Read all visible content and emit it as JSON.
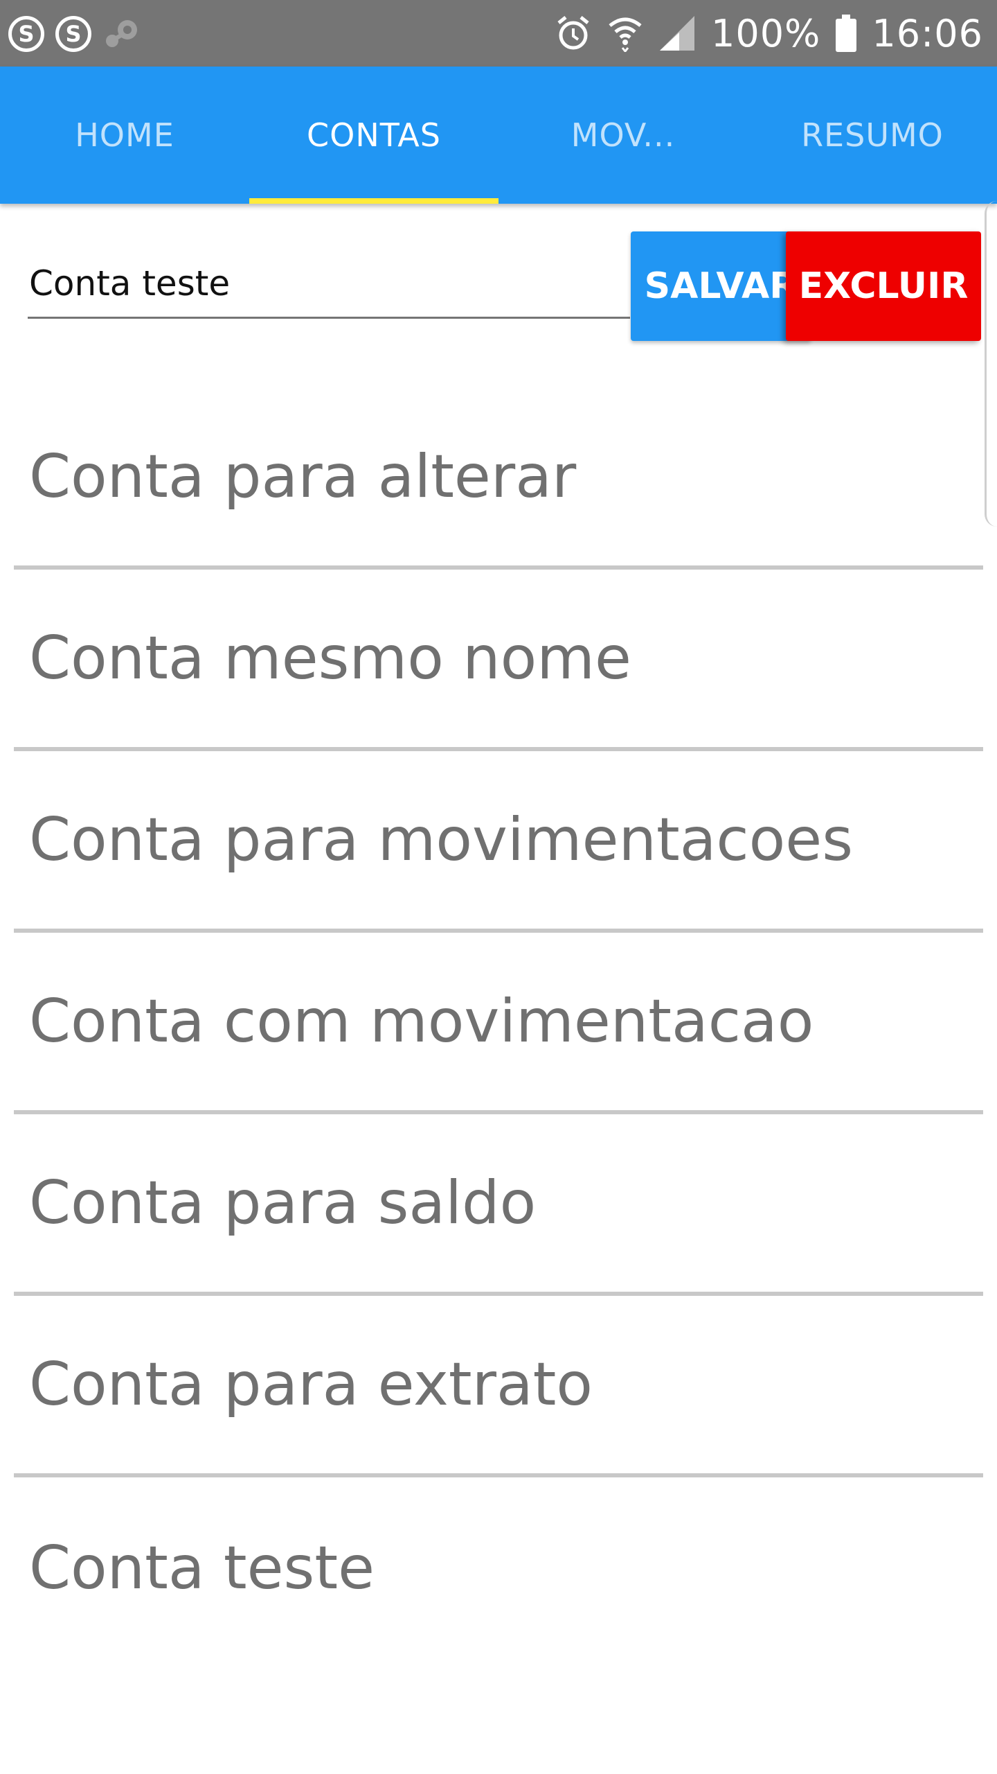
{
  "status_bar": {
    "icons_left": [
      "skype-icon",
      "skype-icon",
      "steam-icon"
    ],
    "icons_right": [
      "alarm-icon",
      "wifi-icon",
      "signal-icon"
    ],
    "battery": "100%",
    "time": "16:06"
  },
  "tabs": [
    {
      "label": "HOME"
    },
    {
      "label": "CONTAS"
    },
    {
      "label": "MOV..."
    },
    {
      "label": "RESUMO"
    }
  ],
  "active_tab": "CONTAS",
  "form": {
    "account_name_value": "Conta teste",
    "save_label": "SALVAR",
    "delete_label": "EXCLUIR"
  },
  "accounts": [
    {
      "name": "Conta para alterar"
    },
    {
      "name": "Conta mesmo nome"
    },
    {
      "name": "Conta para movimentacoes"
    },
    {
      "name": "Conta com movimentacao"
    },
    {
      "name": "Conta para saldo"
    },
    {
      "name": "Conta para extrato"
    },
    {
      "name": "Conta teste"
    }
  ],
  "colors": {
    "primary": "#2196F3",
    "danger": "#EE0000",
    "indicator": "#FFEB3B",
    "status_bar": "#757575"
  }
}
